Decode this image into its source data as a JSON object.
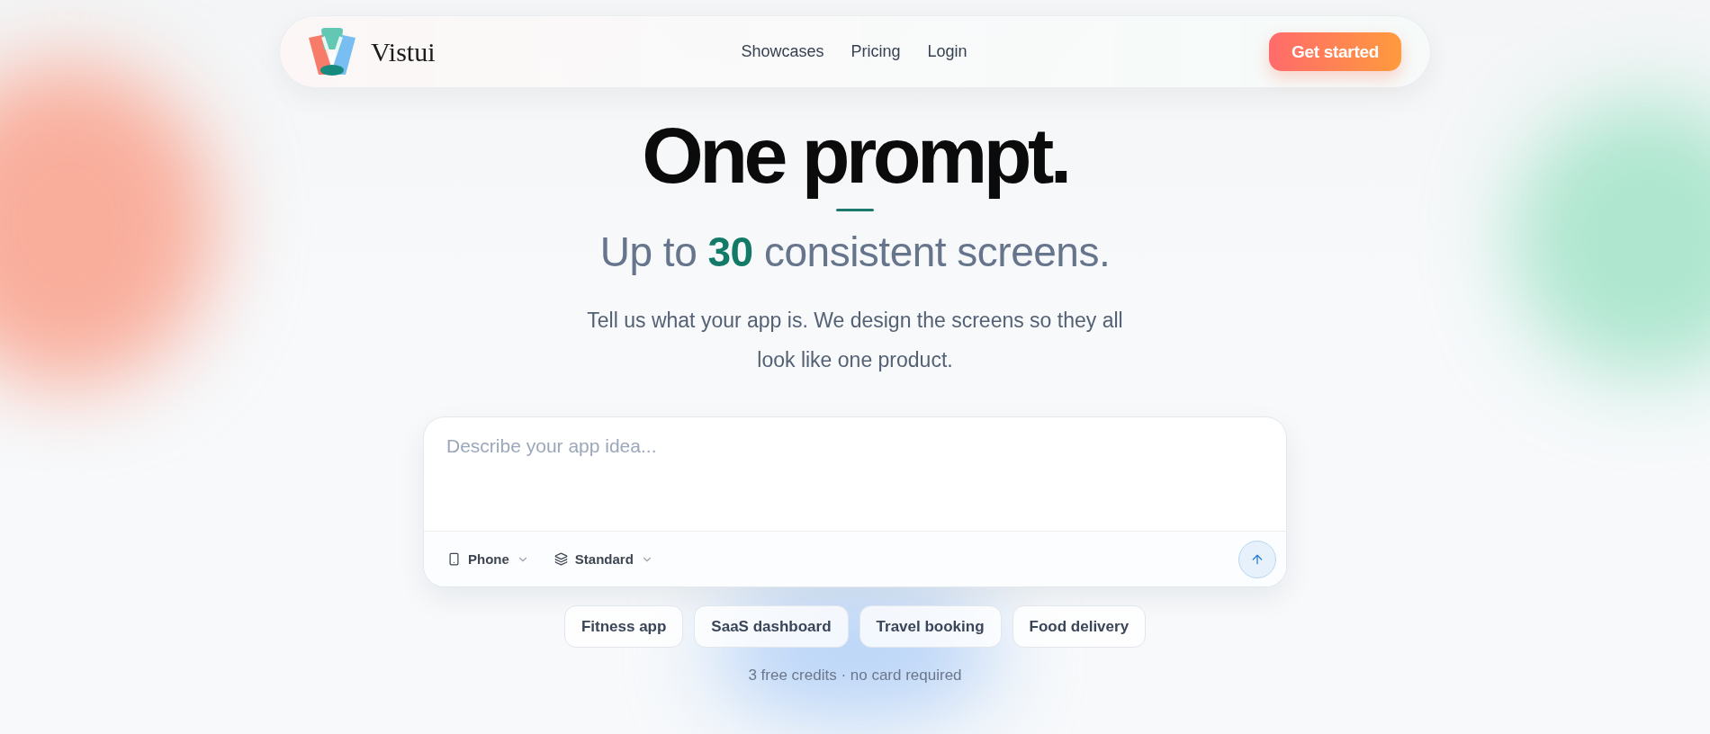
{
  "nav": {
    "brand": "Vistui",
    "links": [
      {
        "label": "Showcases"
      },
      {
        "label": "Pricing"
      },
      {
        "label": "Login"
      }
    ],
    "cta": "Get started"
  },
  "hero": {
    "title": "One prompt.",
    "subtitle": "Up to **30** consistent screens.",
    "description": "Tell us what your app is. We design the screens so they all look like one product."
  },
  "prompt": {
    "placeholder": "Describe your app idea...",
    "options": [
      {
        "kind": "device",
        "label": "Phone"
      },
      {
        "kind": "mode",
        "label": "Standard"
      }
    ]
  },
  "suggestions": [
    {
      "label": "Fitness app"
    },
    {
      "label": "SaaS dashboard"
    },
    {
      "label": "Travel booking"
    },
    {
      "label": "Food delivery"
    }
  ],
  "note": "3 free credits · no card required"
}
